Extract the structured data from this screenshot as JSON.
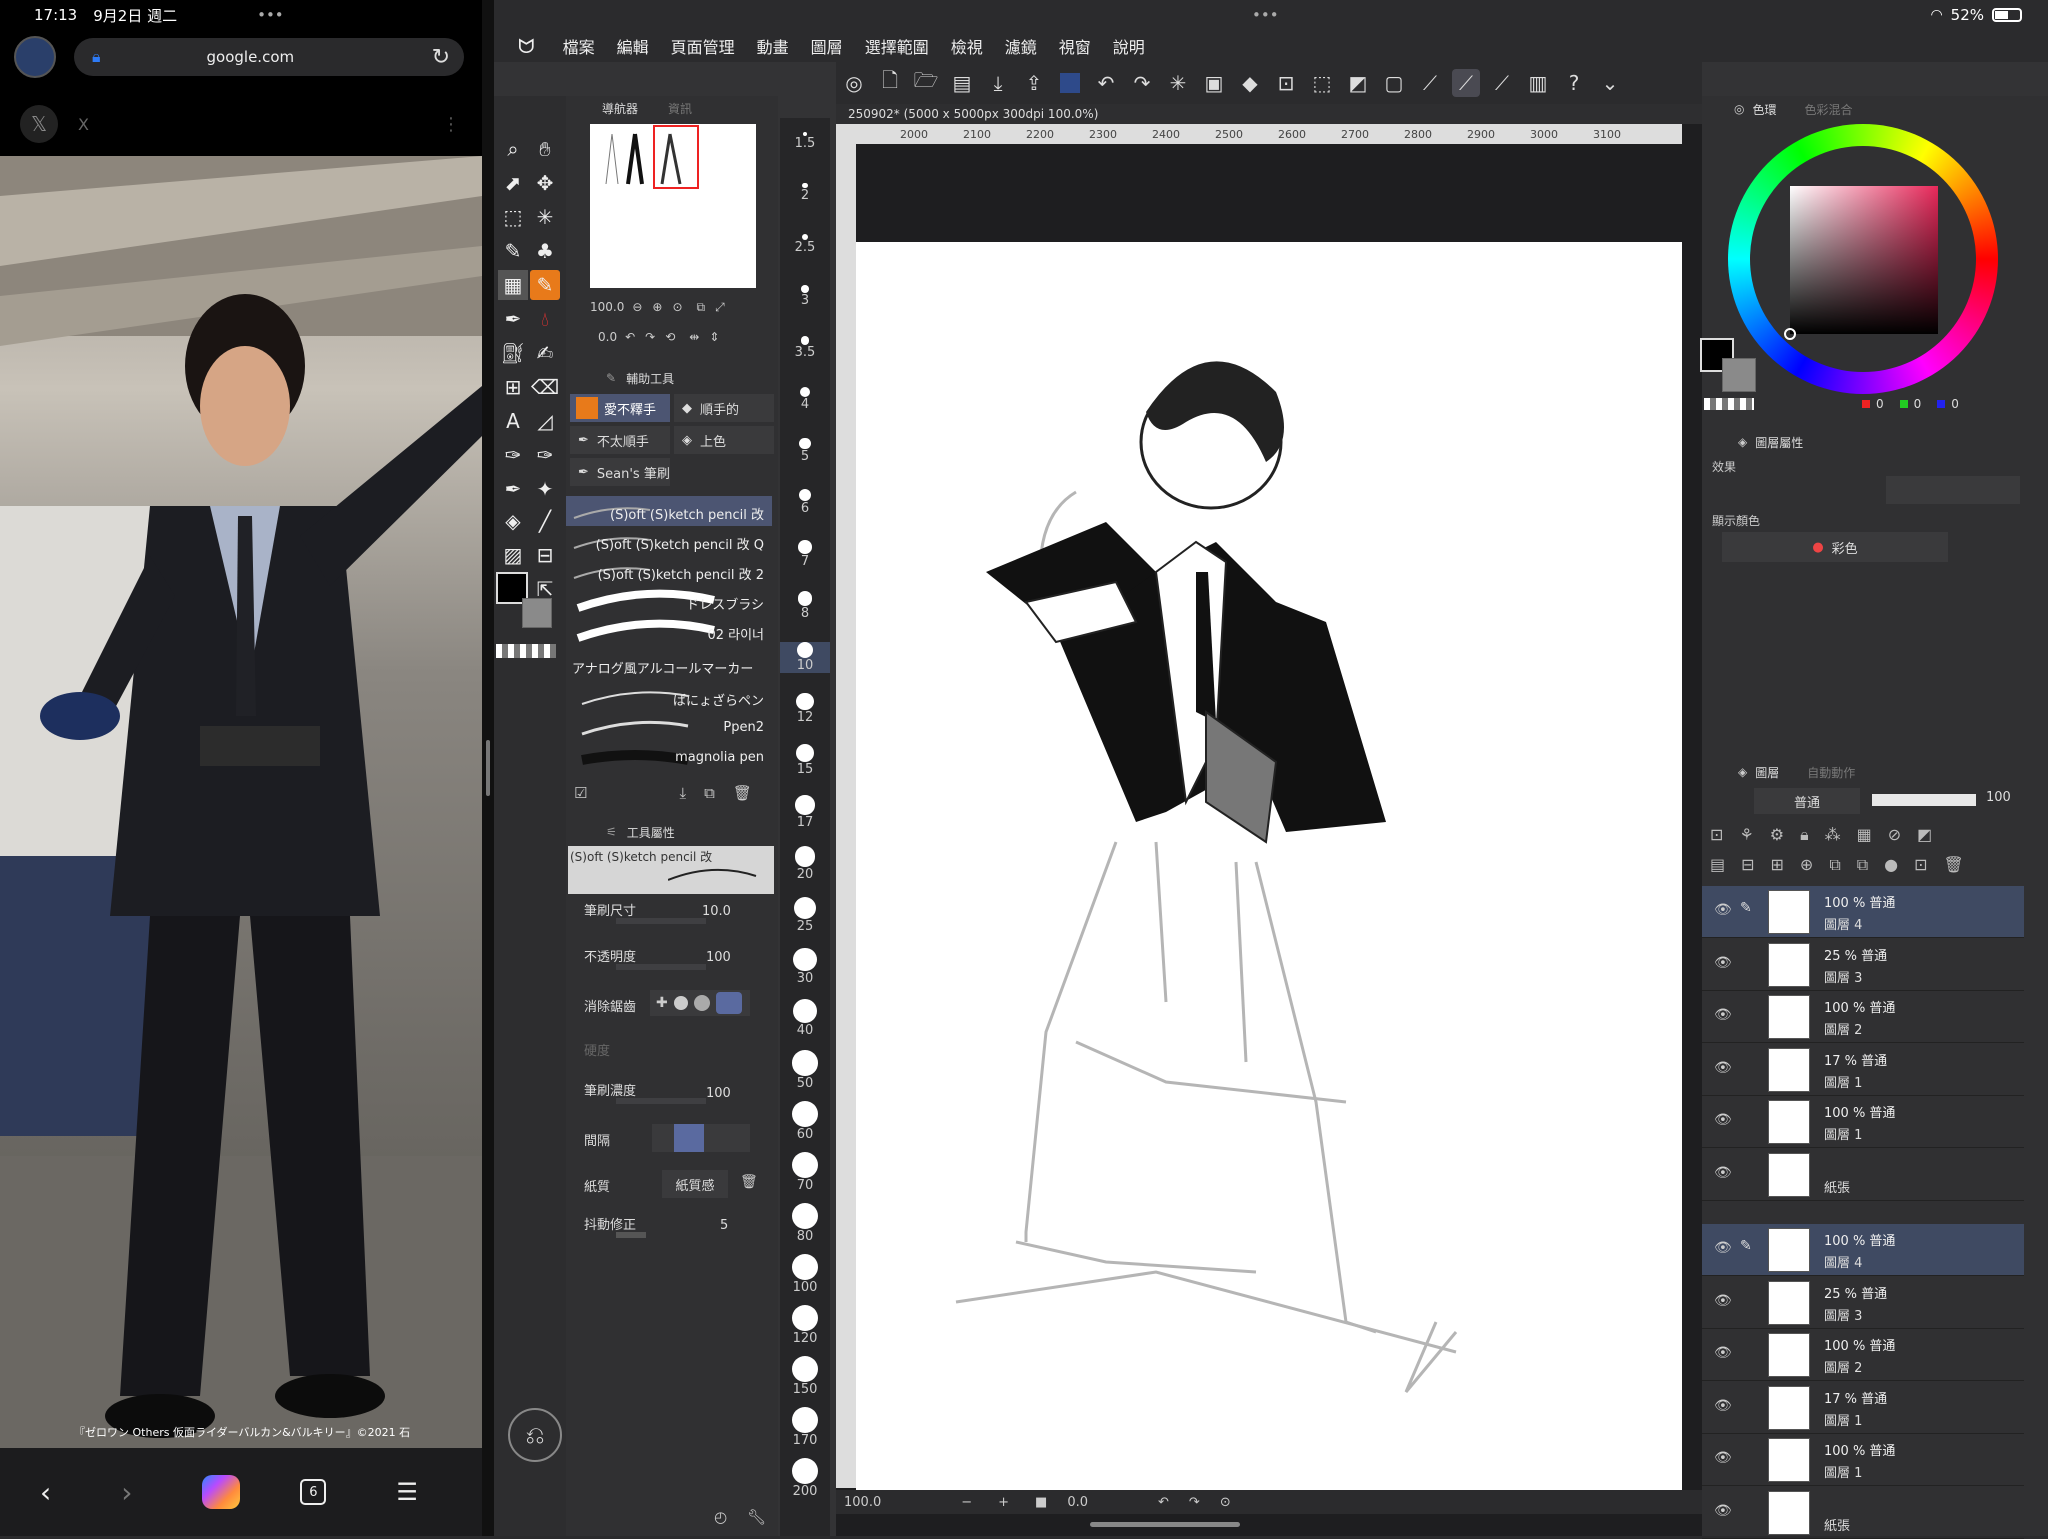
{
  "browser": {
    "time": "17:13",
    "date": "9月2日 週二",
    "dots": "•••",
    "url": "google.com",
    "tab_label": "X",
    "caption": "『ゼロワン Others 仮面ライダーバルカン&バルキリー』©2021 石",
    "tab_count": "6"
  },
  "status": {
    "dots": "•••",
    "battery": "52%"
  },
  "menu": [
    "檔案",
    "編輯",
    "頁面管理",
    "動畫",
    "圖層",
    "選擇範圍",
    "檢視",
    "濾鏡",
    "視窗",
    "說明"
  ],
  "navigator": {
    "tab1": "導航器",
    "tab2": "資訊",
    "zoom": "100.0",
    "rotate": "0.0"
  },
  "subtool": {
    "title": "輔助工具",
    "groups": [
      "愛不釋手",
      "順手的",
      "不太順手",
      "上色",
      "Sean's 筆刷"
    ],
    "brushes": [
      "(S)oft (S)ketch pencil 改",
      "(S)oft (S)ketch pencil 改 Q",
      "(S)oft (S)ketch pencil 改 2",
      "ドレスブラシ",
      "02 라이너",
      "アナログ風アルコールマーカー",
      "ぱにょざらペン",
      "Ppen2",
      "magnolia pen"
    ]
  },
  "toolprop": {
    "title": "工具屬性",
    "current": "(S)oft (S)ketch pencil 改",
    "size_label": "筆刷尺寸",
    "size": "10.0",
    "opacity_label": "不透明度",
    "opacity": "100",
    "aa_label": "消除鋸齒",
    "hardness_label": "硬度",
    "density_label": "筆刷濃度",
    "density": "100",
    "spacing_label": "間隔",
    "paper_label": "紙質",
    "paper_btn": "紙質感",
    "stabilize_label": "抖動修正",
    "stabilize": "5"
  },
  "sizes": [
    "1.5",
    "2",
    "2.5",
    "3",
    "3.5",
    "4",
    "5",
    "6",
    "7",
    "8",
    "10",
    "12",
    "15",
    "17",
    "20",
    "25",
    "30",
    "40",
    "50",
    "60",
    "70",
    "80",
    "100",
    "120",
    "150",
    "170",
    "200"
  ],
  "canvas": {
    "title": "250902* (5000 x 5000px 300dpi 100.0%)",
    "ruler": [
      "2000",
      "2100",
      "2200",
      "2300",
      "2400",
      "2500",
      "2600",
      "2700",
      "2800",
      "2900",
      "3000",
      "3100"
    ],
    "zoom": "100.0",
    "rotate": "0.0"
  },
  "color": {
    "tab1": "色環",
    "tab2": "色彩混合",
    "r": "0",
    "g": "0",
    "b": "0"
  },
  "layerprop": {
    "tab": "圖層屬性",
    "effect": "效果",
    "display_color": "顯示顏色",
    "color_mode": "彩色"
  },
  "layers": {
    "tab1": "圖層",
    "tab2": "自動動作",
    "blend": "普通",
    "opacity": "100",
    "list": [
      {
        "op": "100 %  普通",
        "name": "圖層 4"
      },
      {
        "op": "25 %  普通",
        "name": "圖層 3"
      },
      {
        "op": "100 %  普通",
        "name": "圖層 2"
      },
      {
        "op": "17 %  普通",
        "name": "圖層 1"
      },
      {
        "op": "100 %  普通",
        "name": "圖層 1"
      },
      {
        "op": "",
        "name": "紙張"
      }
    ],
    "list2": [
      {
        "op": "100 %  普通",
        "name": "圖層 4"
      },
      {
        "op": "25 %  普通",
        "name": "圖層 3"
      },
      {
        "op": "100 %  普通",
        "name": "圖層 2"
      },
      {
        "op": "17 %  普通",
        "name": "圖層 1"
      },
      {
        "op": "100 %  普通",
        "name": "圖層 1"
      },
      {
        "op": "",
        "name": "紙張"
      }
    ]
  }
}
